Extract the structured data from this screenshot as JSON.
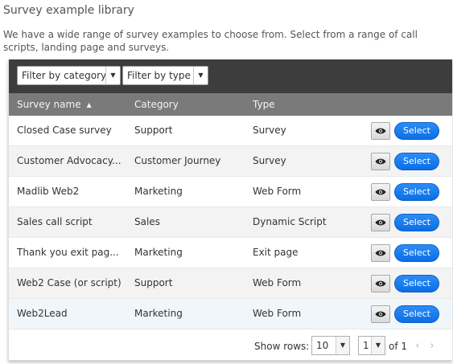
{
  "page": {
    "title": "Survey example library",
    "intro": "We have a wide range of survey examples to choose from. Select from a range of call scripts, landing page and surveys."
  },
  "toolbar": {
    "filter_category": "Filter by category",
    "filter_type": "Filter by type"
  },
  "table": {
    "columns": {
      "name": "Survey name",
      "category": "Category",
      "type": "Type"
    },
    "sort": {
      "column": "name",
      "direction": "ascending"
    },
    "rows": [
      {
        "name": "Closed Case survey",
        "category": "Support",
        "type": "Survey",
        "select_label": "Select"
      },
      {
        "name": "Customer Advocacy...",
        "category": "Customer Journey",
        "type": "Survey",
        "select_label": "Select"
      },
      {
        "name": "Madlib Web2",
        "category": "Marketing",
        "type": "Web Form",
        "select_label": "Select"
      },
      {
        "name": "Sales call script",
        "category": "Sales",
        "type": "Dynamic Script",
        "select_label": "Select"
      },
      {
        "name": "Thank you exit pag...",
        "category": "Marketing",
        "type": "Exit page",
        "select_label": "Select"
      },
      {
        "name": "Web2 Case (or script)",
        "category": "Support",
        "type": "Web Form",
        "select_label": "Select"
      },
      {
        "name": "Web2Lead",
        "category": "Marketing",
        "type": "Web Form",
        "select_label": "Select"
      }
    ]
  },
  "pager": {
    "show_rows_label": "Show rows:",
    "rows_per_page": "10",
    "current_page": "1",
    "of_label": "of 1"
  },
  "icons": {
    "preview": "eye-icon",
    "sort": "sort-ascending-icon",
    "dropdown": "caret-down-icon",
    "prev": "chevron-left-icon",
    "next": "chevron-right-icon"
  },
  "colors": {
    "toolbar_bg": "#3d3d3d",
    "header_bg": "#7a7a7a",
    "select_button": "#1a7df0"
  }
}
